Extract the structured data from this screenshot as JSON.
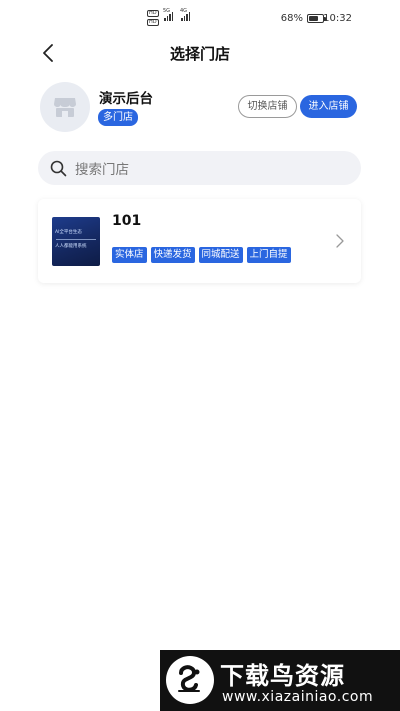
{
  "status_bar": {
    "sim1": "HD",
    "sim2": "HD",
    "net1": "5G",
    "net2": "4G",
    "battery_text": "68%",
    "battery_level": 0.68,
    "time": "10:32"
  },
  "nav": {
    "title": "选择门店",
    "back_icon": "chevron-left-icon"
  },
  "company": {
    "name": "演示后台",
    "badge": "多门店",
    "avatar_icon": "store-icon",
    "switch_label": "切换店铺",
    "enter_label": "进入店铺"
  },
  "search": {
    "placeholder": "搜索门店",
    "icon": "search-icon"
  },
  "stores": [
    {
      "name": "101",
      "thumb_lines": [
        "AI全平台生态",
        "人人都能用系统"
      ],
      "tags": [
        "实体店",
        "快递发货",
        "同城配送",
        "上门自提"
      ]
    }
  ],
  "watermark": {
    "title": "下载鸟资源",
    "url": "www.xiazainiao.com"
  },
  "colors": {
    "accent": "#2a66e0",
    "search_bg": "#f1f2f6",
    "avatar_bg": "#e9ecf2"
  }
}
